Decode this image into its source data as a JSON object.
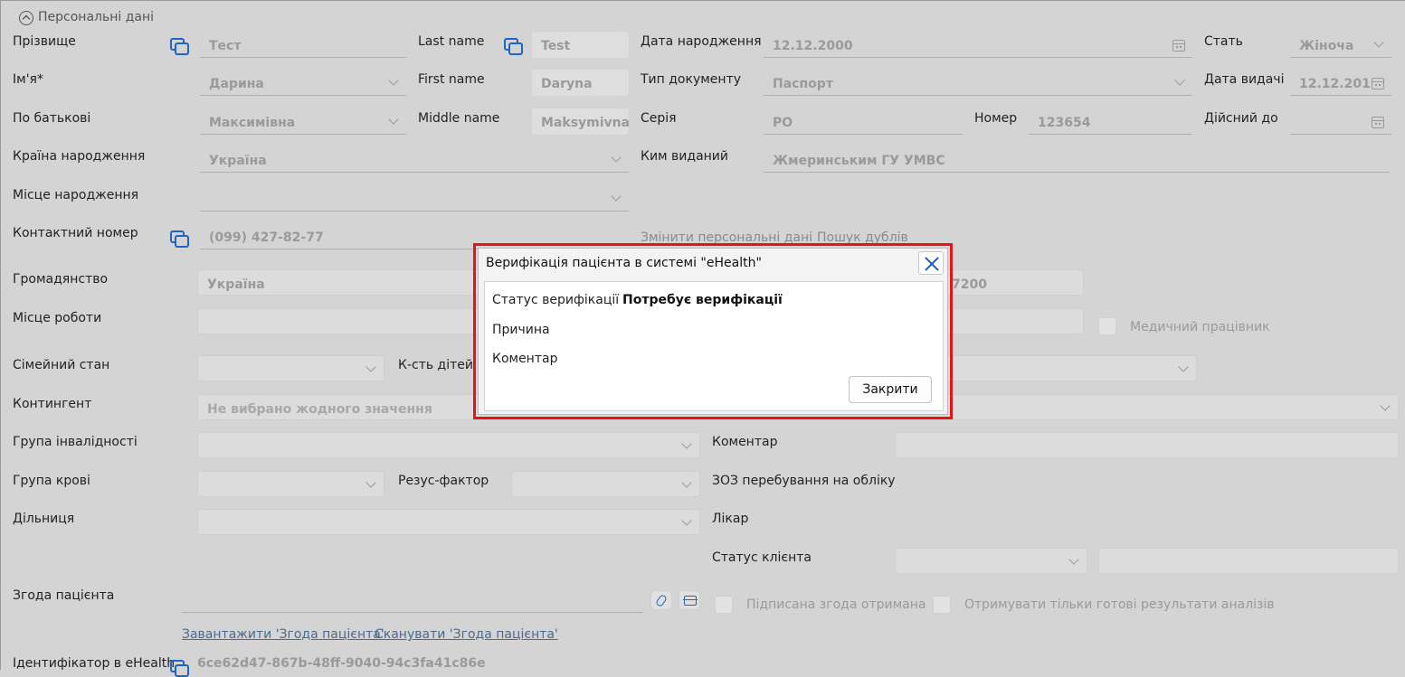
{
  "section": {
    "title": "Персональні дані"
  },
  "personal": {
    "surname": {
      "label": "Прізвище",
      "value": "Тест"
    },
    "last_name": {
      "label": "Last name",
      "value": "Test"
    },
    "birth_date": {
      "label": "Дата народження",
      "value": "12.12.2000"
    },
    "sex": {
      "label": "Стать",
      "value": "Жіноча"
    },
    "first_name_ua": {
      "label": "Ім'я*",
      "value": "Дарина"
    },
    "first_name": {
      "label": "First name",
      "value": "Daryna"
    },
    "doc_type": {
      "label": "Тип документу",
      "value": "Паспорт"
    },
    "issue_date": {
      "label": "Дата видачі",
      "value": "12.12.201"
    },
    "patronymic": {
      "label": "По батькові",
      "value": "Максимівна"
    },
    "middle_name": {
      "label": "Middle name",
      "value": "Maksymivna"
    },
    "series": {
      "label": "Серія",
      "value": "РО"
    },
    "number": {
      "label": "Номер",
      "value": "123654"
    },
    "valid_until": {
      "label": "Дійсний до",
      "value": ""
    },
    "birth_country": {
      "label": "Країна народження",
      "value": "Україна"
    },
    "issued_by": {
      "label": "Ким виданий",
      "value": "Жмеринським ГУ УМВС"
    },
    "birth_place": {
      "label": "Місце народження",
      "value": ""
    },
    "phone": {
      "label": "Контактний номер",
      "value": "(099) 427-82-77"
    },
    "change_personal_link": "Змінити персональні дані",
    "search_duplicates_link": "Пошук дублів",
    "citizenship": {
      "label": "Громадянство",
      "value": "Україна"
    },
    "partial_value": "7200",
    "workplace": {
      "label": "Місце роботи",
      "value": ""
    },
    "medical_worker": "Медичний працівник",
    "marital_status": {
      "label": "Сімейний стан",
      "value": ""
    },
    "children_count": {
      "label": "К-сть дітей"
    },
    "contingent": {
      "label": "Контингент",
      "placeholder": "Не вибрано жодного значення"
    },
    "disability_group": {
      "label": "Група інвалідності",
      "value": ""
    },
    "comment": {
      "label": "Коментар",
      "value": ""
    },
    "blood_group": {
      "label": "Група крові",
      "value": ""
    },
    "rh_factor": {
      "label": "Резус-фактор",
      "value": ""
    },
    "registration_facility": {
      "label": "ЗОЗ перебування на обліку"
    },
    "district": {
      "label": "Дільниця",
      "value": ""
    },
    "doctor": {
      "label": "Лікар"
    },
    "client_status": {
      "label": "Статус клієнта"
    },
    "consent": {
      "label": "Згода пацієнта",
      "upload_link": "Завантажити 'Згода пацієнта'",
      "scan_link": "Сканувати 'Згода пацієнта'",
      "signed_received": "Підписана згода отримана",
      "ready_results_only": "Отримувати тільки готові результати аналізів"
    },
    "ehealth_id": {
      "label": "Ідентифікатор в eHealth",
      "value": "6ce62d47-867b-48ff-9040-94c3fa41c86e"
    }
  },
  "modal": {
    "title": "Верифікація пацієнта в системі \"eHealth\"",
    "status_label": "Статус верифікації",
    "status_value": "Потребує верифікації",
    "reason_label": "Причина",
    "comment_label": "Коментар",
    "close_button": "Закрити"
  }
}
